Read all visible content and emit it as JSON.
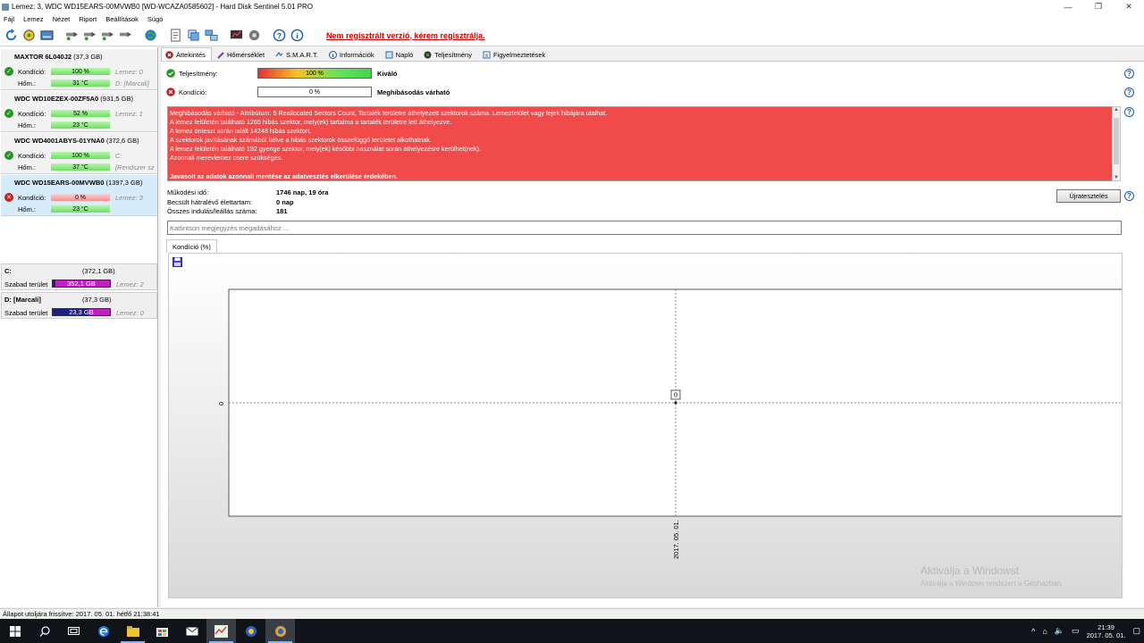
{
  "window": {
    "title": "Lemez: 3, WDC WD15EARS-00MVWB0 [WD-WCAZA0585602]  -  Hard Disk Sentinel 5.01 PRO",
    "minimize": "—",
    "maximize": "❐",
    "close": "✕"
  },
  "menu": [
    "Fájl",
    "Lemez",
    "Nézet",
    "Riport",
    "Beállítások",
    "Súgó"
  ],
  "toolbar": {
    "unregistered_warning": "Nem regisztrált verzió, kérem regisztrálja.",
    "icons": [
      "refresh-icon",
      "status-icon",
      "drive-icon",
      "tool-icon-1",
      "tool-icon-2",
      "tool-icon-3",
      "tool-icon-4",
      "globe-icon",
      "report-icon",
      "copy-icon",
      "network-icon",
      "chart-icon",
      "settings-icon",
      "help-icon",
      "info-icon"
    ]
  },
  "disks": [
    {
      "name": "MAXTOR 6L040J2",
      "size": "(37,3 GB)",
      "cond_label": "Kondíció:",
      "cond_value": "100 %",
      "cond_level": 1.0,
      "temp_label": "Hőm.:",
      "temp_value": "31 °C",
      "side_1": "Lemez: 0",
      "side_2": "D: [Marcali]",
      "status": "ok"
    },
    {
      "name": "WDC WD10EZEX-00ZF5A0",
      "size": "(931,5 GB)",
      "cond_label": "Kondíció:",
      "cond_value": "52 %",
      "cond_level": 0.52,
      "temp_label": "Hőm.:",
      "temp_value": "23 °C",
      "side_1": "Lemez: 1",
      "side_2": "",
      "status": "ok"
    },
    {
      "name": "WDC WD4001ABYS-01YNA0",
      "size": "(372,6 GB)",
      "cond_label": "Kondíció:",
      "cond_value": "100 %",
      "cond_level": 1.0,
      "temp_label": "Hőm.:",
      "temp_value": "37 °C",
      "side_1": "C:",
      "side_2": "[Rendszer sz",
      "status": "ok"
    },
    {
      "name": "WDC WD15EARS-00MVWB0",
      "size": "(1397,3 GB)",
      "cond_label": "Kondíció:",
      "cond_value": "0 %",
      "cond_level": 0.0,
      "temp_label": "Hőm.:",
      "temp_value": "23 °C",
      "side_1": "Lemez: 3",
      "side_2": "",
      "status": "bad"
    }
  ],
  "partitions": [
    {
      "name": "C:",
      "size": "(372,1 GB)",
      "free_label": "Szabad terület",
      "free_value": "352,1 GB",
      "used_level": 0.05,
      "disk": "Lemez: 2"
    },
    {
      "name": "D: [Marcali]",
      "size": "(37,3 GB)",
      "free_label": "Szabad terület",
      "free_value": "23,3 GB",
      "used_level": 0.62,
      "disk": "Lemez: 0"
    }
  ],
  "tabs": [
    "Áttekintés",
    "Hőmérséklet",
    "S.M.A.R.T.",
    "Információk",
    "Napló",
    "Teljesítmény",
    "Figyelmeztetések"
  ],
  "overview": {
    "performance_label": "Teljesítmény:",
    "performance_value": "100 %",
    "performance_level": 1.0,
    "performance_verdict": "Kiváló",
    "condition_label": "Kondíció:",
    "condition_value": "0 %",
    "condition_level": 0.0,
    "condition_verdict": "Meghibásodás várható",
    "alert_lines": [
      "Meghibásodás várható - Attribútum: 5 Reallocated Sectors Count, Tartalék területre áthelyezett szektorok száma. Lemezfelület vagy fejek hibájára utalhat.",
      "A lemez felületén található 1265 hibás szektor, mely(ek) tartalma a tartalék területre lett áthelyezve.",
      "A lemez önteszt során talált 14248 hibás szektort.",
      "A szektorok javításának számából ítélve a hibás szektorok összefüggő területet alkothatnak.",
      "A lemez felületén található 192 gyenge szektor, mely(ek) későbbi használat során áthelyezésre kerülhet(nek).",
      "Azonnali merevlemez csere szükséges.",
      ""
    ],
    "alert_bold": "Javasolt az adatok azonnali mentése az adatvesztés elkerülése érdekében.",
    "stats": [
      {
        "label": "Működési idő:",
        "value": "1746 nap, 19 óra"
      },
      {
        "label": "Becsült hátralévő élettartam:",
        "value": "0 nap"
      },
      {
        "label": "Összes indulás/leállás száma:",
        "value": "181"
      }
    ],
    "restart_button": "Újratesztelés",
    "note_placeholder": "Kattintson megjegyzés megadásához ...",
    "chart_tab": "Kondíció  (%)"
  },
  "chart_data": {
    "type": "line",
    "title": "",
    "xlabel": "",
    "ylabel": "",
    "x": [
      "2017. 05. 01."
    ],
    "series": [
      {
        "values": [
          0
        ]
      }
    ],
    "point_labels": [
      "0"
    ],
    "y_ticks": [
      "0"
    ],
    "grid": true
  },
  "watermark": {
    "line1": "Aktiválja a Windowst",
    "line2": "Aktiválja a Windows rendszert a Gépházban."
  },
  "statusbar": "Állapot utoljára frissítve: 2017. 05. 01. hétfő 21:38:41",
  "taskbar": {
    "time": "21:39",
    "date": "2017. 05. 01.",
    "tray_up": "^"
  },
  "colors": {
    "alert_bg": "#f04a4a",
    "warning_text": "#d00000",
    "ok": "#1e9a1e",
    "bad": "#c81e1e"
  }
}
